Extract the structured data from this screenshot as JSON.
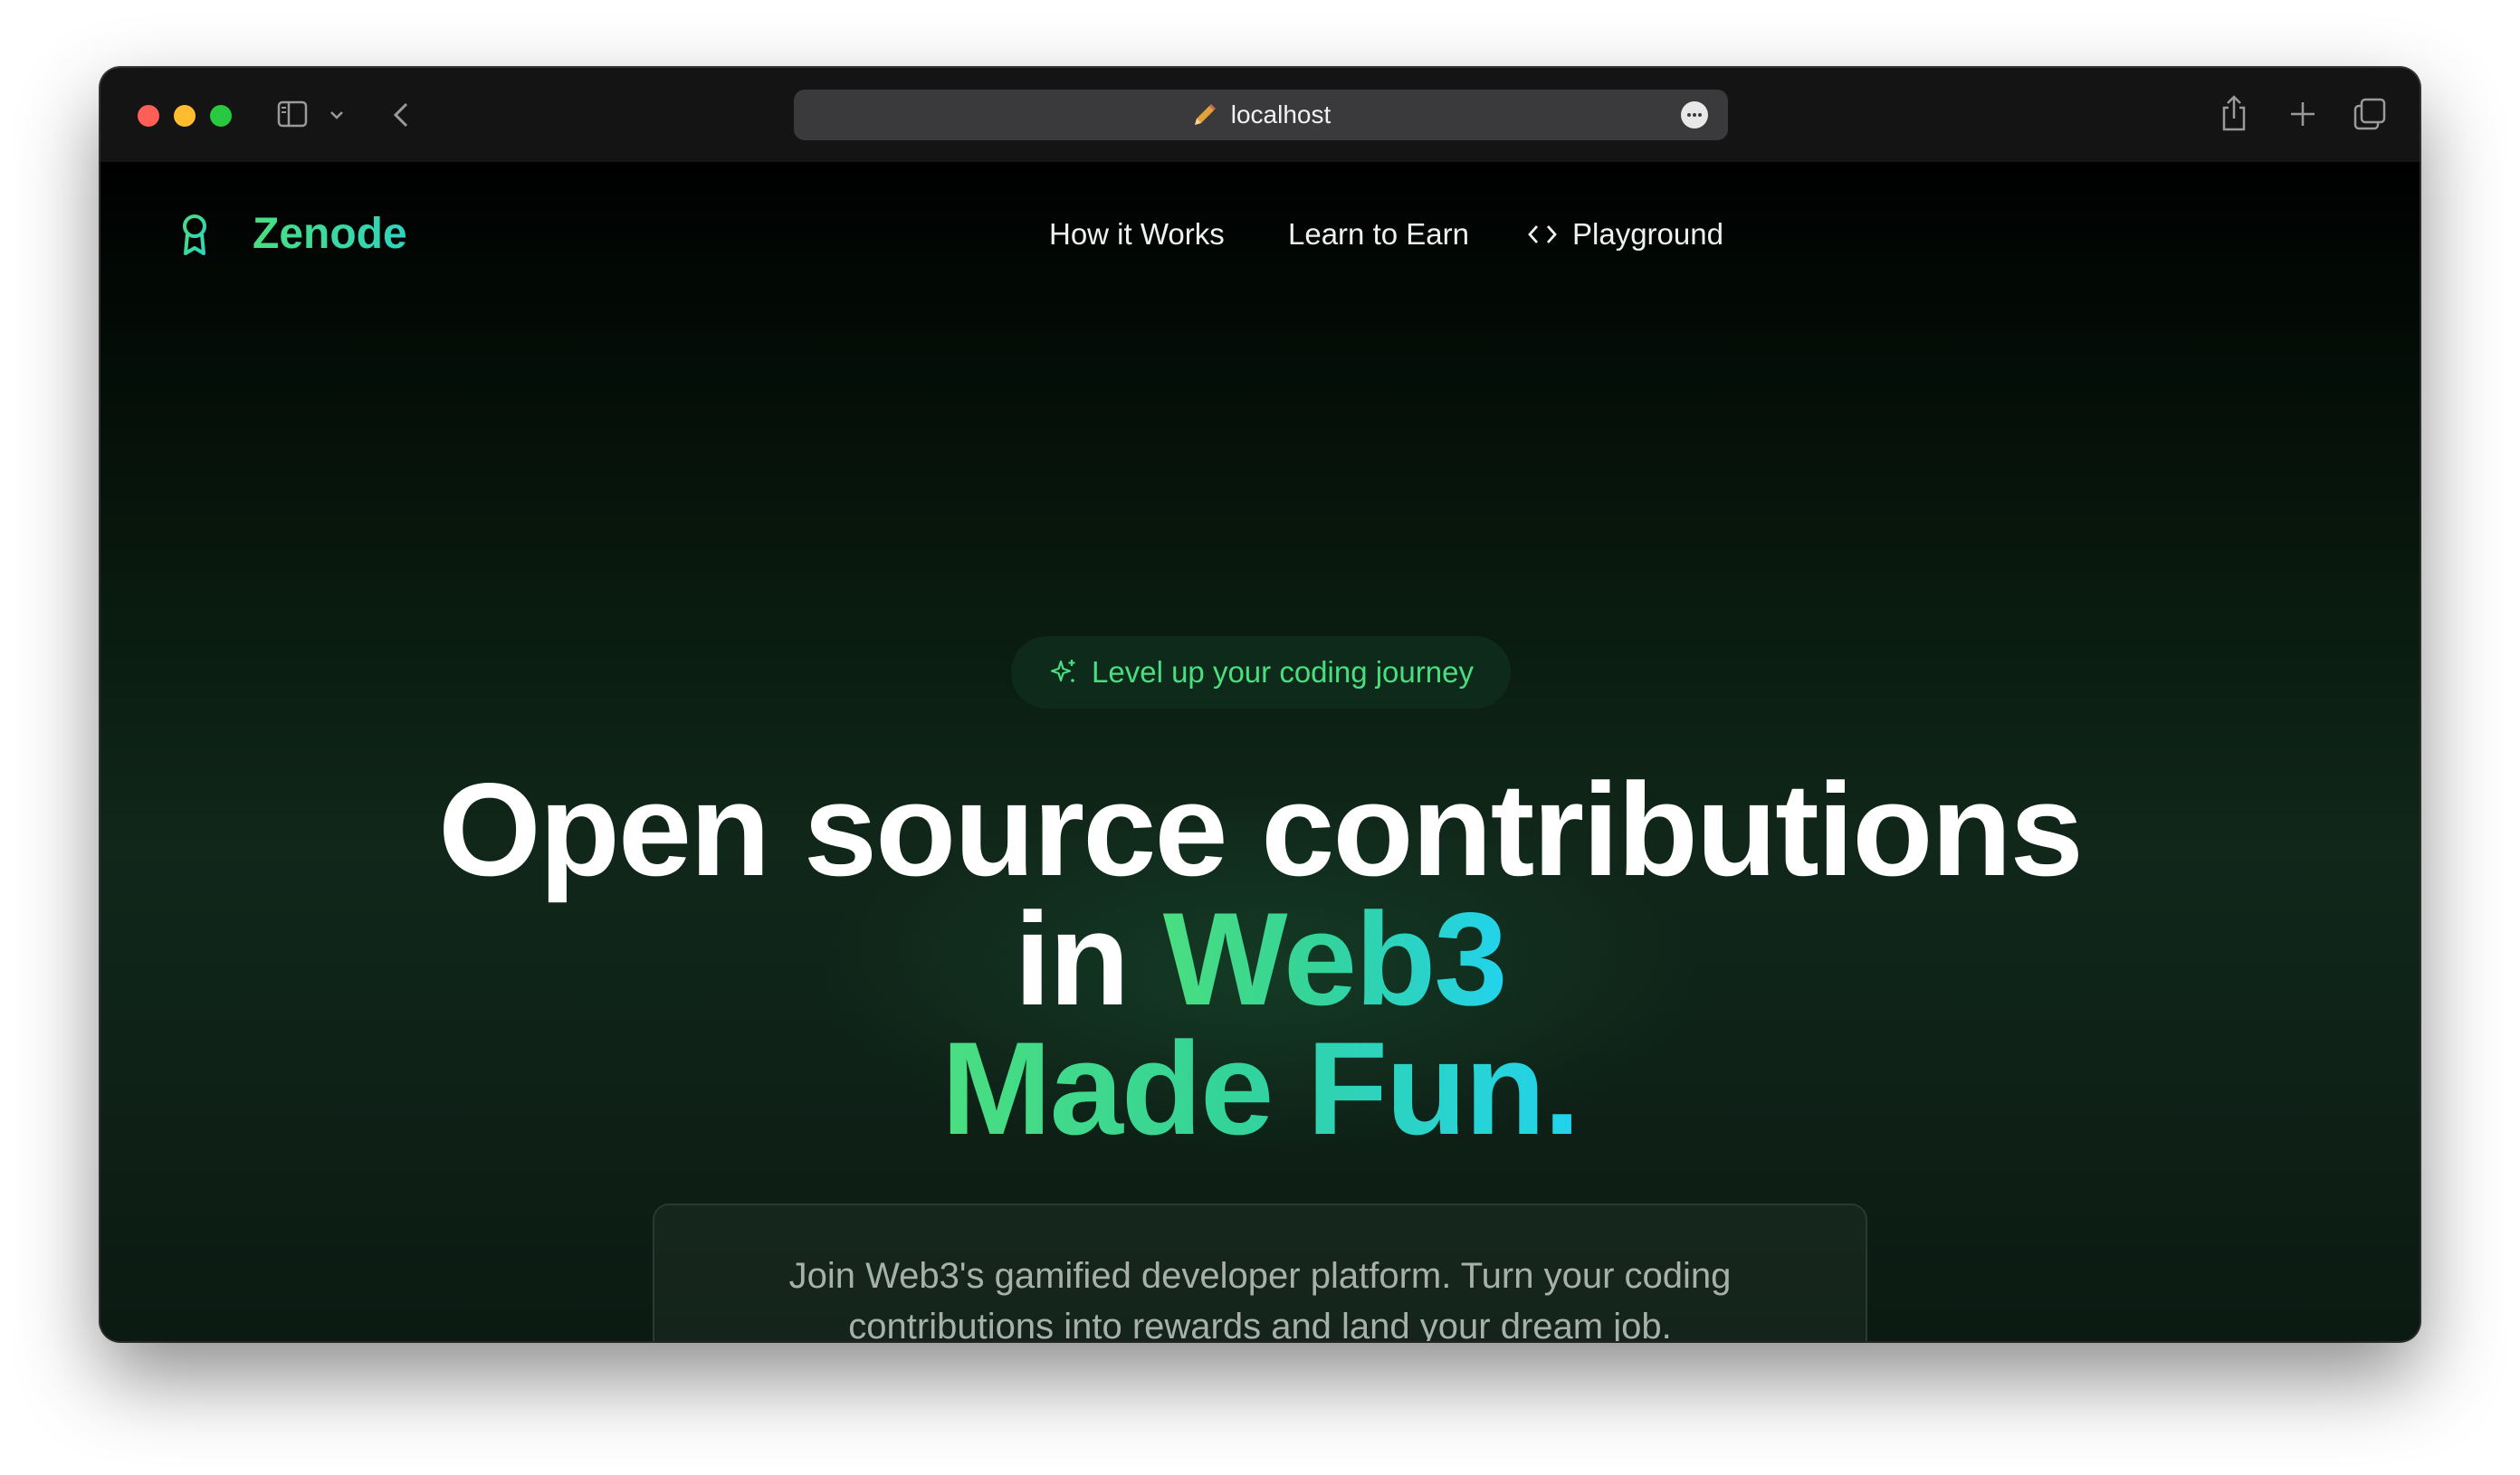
{
  "browser": {
    "url": "localhost"
  },
  "site": {
    "brand": "Zenode",
    "nav": {
      "how_it_works": "How it Works",
      "learn_to_earn": "Learn to Earn",
      "playground": "Playground"
    }
  },
  "hero": {
    "badge": "Level up your coding journey",
    "line1": "Open source contributions",
    "line2_prefix": "in",
    "line2_highlight": "Web3",
    "line3": "Made Fun.",
    "subtitle_line1": "Join Web3's gamified developer platform. Turn your coding",
    "subtitle_line2": "contributions into rewards and land your dream job."
  },
  "colors": {
    "accent_green": "#4ade80",
    "accent_cyan": "#22d3ee",
    "background": "#000000"
  }
}
